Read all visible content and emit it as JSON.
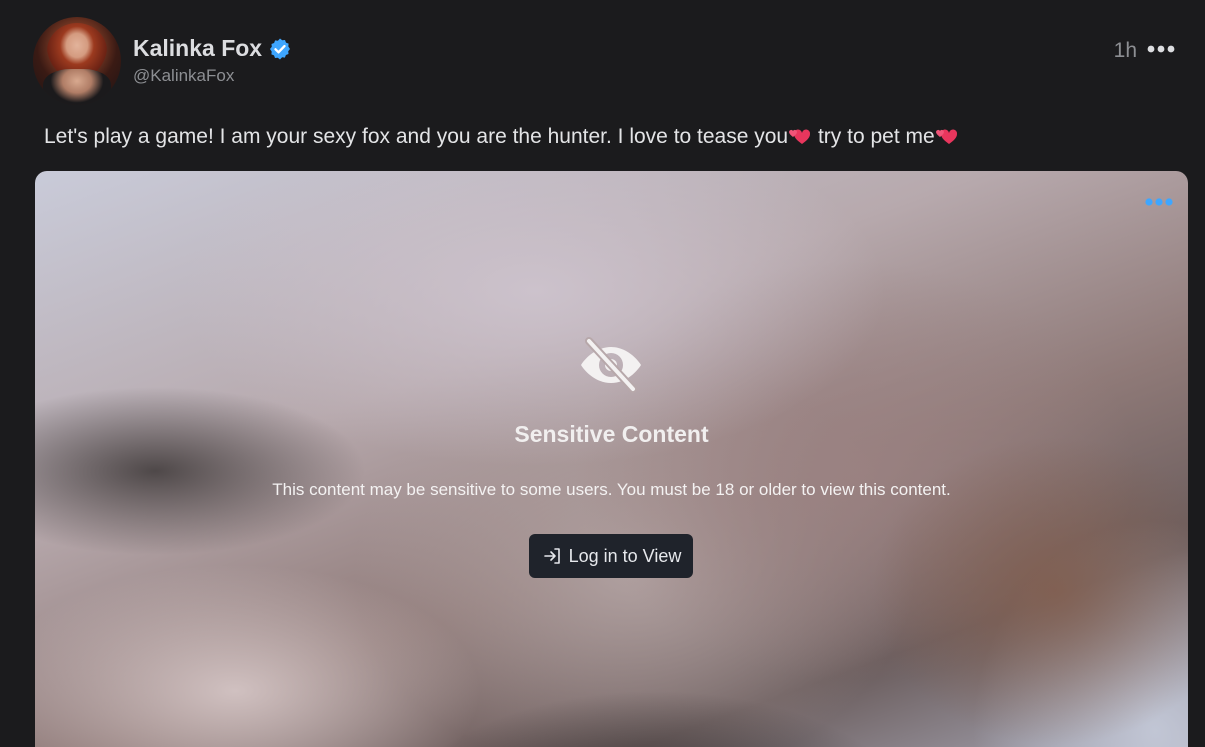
{
  "post": {
    "author": {
      "display_name": "Kalinka Fox",
      "handle": "@KalinkaFox",
      "verified": true,
      "avatar_icon": "avatar-photo"
    },
    "timestamp": "1h",
    "more_icon": "ellipsis-icon",
    "caption": {
      "part1": "Let's play a game! I am your sexy fox and you are the hunter. I love to tease you",
      "part2": " try to pet me",
      "emoji": "two-hearts-emoji"
    },
    "media": {
      "blurred": true,
      "more_icon": "ellipsis-icon",
      "more_icon_color": "#3ea6ff",
      "sensitive": {
        "icon": "eye-slash-icon",
        "title": "Sensitive Content",
        "description": "This content may be sensitive to some users. You must be 18 or older to view this content.",
        "button_label": "Log in to View",
        "button_icon": "login-arrow-icon"
      }
    }
  },
  "colors": {
    "background": "#1b1b1d",
    "verified_badge": "#3ea6ff",
    "heart": "#e8365d",
    "button_bg": "#1f232b",
    "muted_text": "#8d8f93"
  }
}
